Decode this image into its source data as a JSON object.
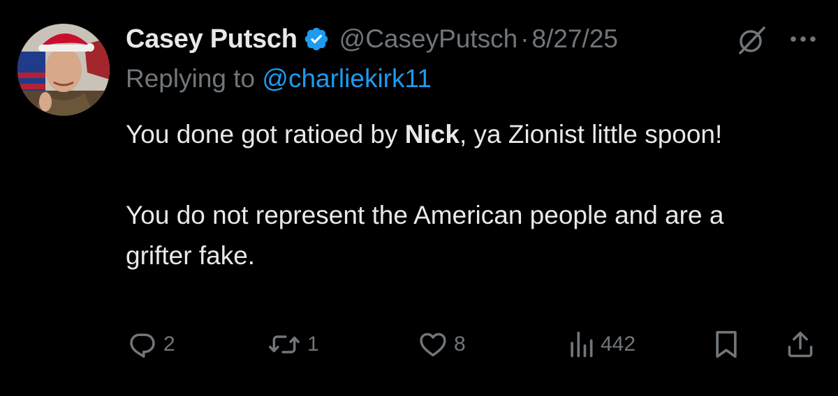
{
  "tweet": {
    "author": {
      "display_name": "Casey Putsch",
      "handle": "@CaseyPutsch",
      "verified": true
    },
    "separator": "·",
    "date": "8/27/25",
    "replying_prefix": "Replying to",
    "replying_to": "@charliekirk11",
    "text": {
      "line1_before": "You done got ratioed by ",
      "line1_bold": "Nick",
      "line1_after": ", ya Zionist little spoon!",
      "para2": "You do not represent the American people and are a grifter fake."
    },
    "stats": {
      "replies": "2",
      "retweets": "1",
      "likes": "8",
      "views": "442"
    }
  },
  "icons": {
    "verified": "verified-badge-icon",
    "grok": "grok-icon",
    "more": "more-icon",
    "reply": "reply-icon",
    "retweet": "retweet-icon",
    "like": "heart-icon",
    "views": "views-chart-icon",
    "bookmark": "bookmark-icon",
    "share": "share-icon"
  },
  "colors": {
    "background": "#000000",
    "primary_text": "#e7e9ea",
    "secondary_text": "#71767b",
    "link": "#1d9bf0",
    "verified": "#1d9bf0"
  }
}
